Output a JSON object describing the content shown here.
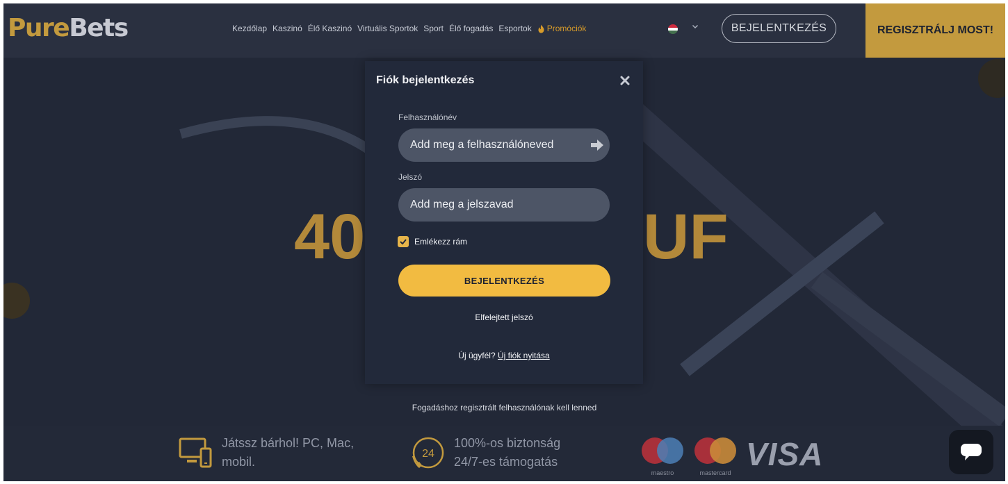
{
  "header": {
    "logo_part1": "Pure",
    "logo_part2": "Bets",
    "nav": [
      "Kezdőlap",
      "Kaszinó",
      "Élő Kaszinó",
      "Virtuális Sportok",
      "Sport",
      "Élő fogadás",
      "Esportok"
    ],
    "promo_label": "Promóciók",
    "login_label": "BEJELENTKEZÉS",
    "register_label": "REGISZTRÁLJ MOST!"
  },
  "hero": {
    "text_left": "40",
    "text_right": "UF",
    "note": "Fogadáshoz regisztrált felhasználónak kell lenned"
  },
  "modal": {
    "title": "Fiók bejelentkezés",
    "username_label": "Felhasználónév",
    "username_placeholder": "Add meg a felhasználóneved",
    "password_label": "Jelszó",
    "password_placeholder": "Add meg a jelszavad",
    "remember_label": "Emlékezz rám",
    "remember_checked": true,
    "submit_label": "BEJELENTKEZÉS",
    "forgot_label": "Elfelejtett jelszó",
    "new_customer_label": "Új ügyfél?",
    "new_account_link": "Új fiók nyitása"
  },
  "features": {
    "devices_line1": "Játssz bárhol! PC, Mac,",
    "devices_line2": "mobil.",
    "support_badge": "24",
    "support_line1": "100%-os biztonság",
    "support_line2": "24/7-es támogatás",
    "cards": [
      "maestro",
      "mastercard"
    ],
    "visa": "VISA"
  },
  "colors": {
    "gold": "#c39a3e",
    "button_yellow": "#f2bb41",
    "background": "#2a3040",
    "modal": "#22293a"
  }
}
